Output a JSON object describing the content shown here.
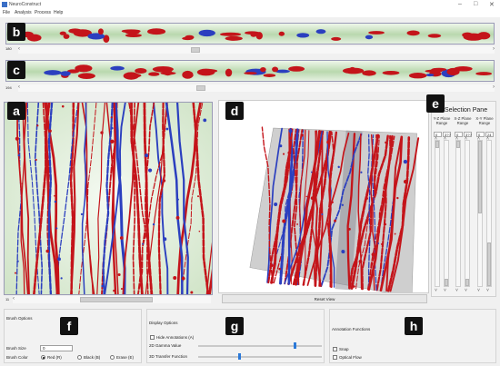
{
  "window": {
    "title": "NeuroConstruct",
    "controls": [
      "–",
      "□",
      "✕"
    ]
  },
  "menu": [
    "File",
    "Analysis",
    "Process",
    "Help"
  ],
  "labels": {
    "a": "a",
    "b": "b",
    "c": "c",
    "d": "d",
    "e": "e",
    "f": "f",
    "g": "g",
    "h": "h"
  },
  "strip_b": {
    "value": "180"
  },
  "strip_c": {
    "value": "194"
  },
  "view_a": {
    "value": "11"
  },
  "reset_view": "Reset View",
  "selection_pane": {
    "title": "Selection Pane",
    "columns": [
      {
        "header": "Y-Z Plane Range",
        "min": "0",
        "max": "3??"
      },
      {
        "header": "X-Z Plane Range",
        "min": "0",
        "max": "3??"
      },
      {
        "header": "X-Y Plane Range",
        "min": "0",
        "max": "24"
      }
    ]
  },
  "brush_options": {
    "title": "Brush Options",
    "size_label": "Brush Size",
    "size_value": "0",
    "color_label": "Brush Color",
    "colors": [
      "Red (R)",
      "Black (B)",
      "Erase (E)"
    ],
    "selected_color": "Red (R)"
  },
  "display_options": {
    "title": "Display Options",
    "hide_annotations": "Hide Annotations (A)",
    "gamma_label": "2D Gamma Value",
    "gamma_level": 0.77,
    "transfer_label": "3D Transfer Function",
    "transfer_level": 0.32
  },
  "annotation_functions": {
    "title": "Annotation Functions",
    "snap": "Snap",
    "optical_flow": "Optical Flow"
  },
  "colors": {
    "neuron_red": "#c4141a",
    "annotation_blue": "#2b3fbf",
    "background_green": "#cfe3c6",
    "accent_blue": "#2b79d8"
  }
}
